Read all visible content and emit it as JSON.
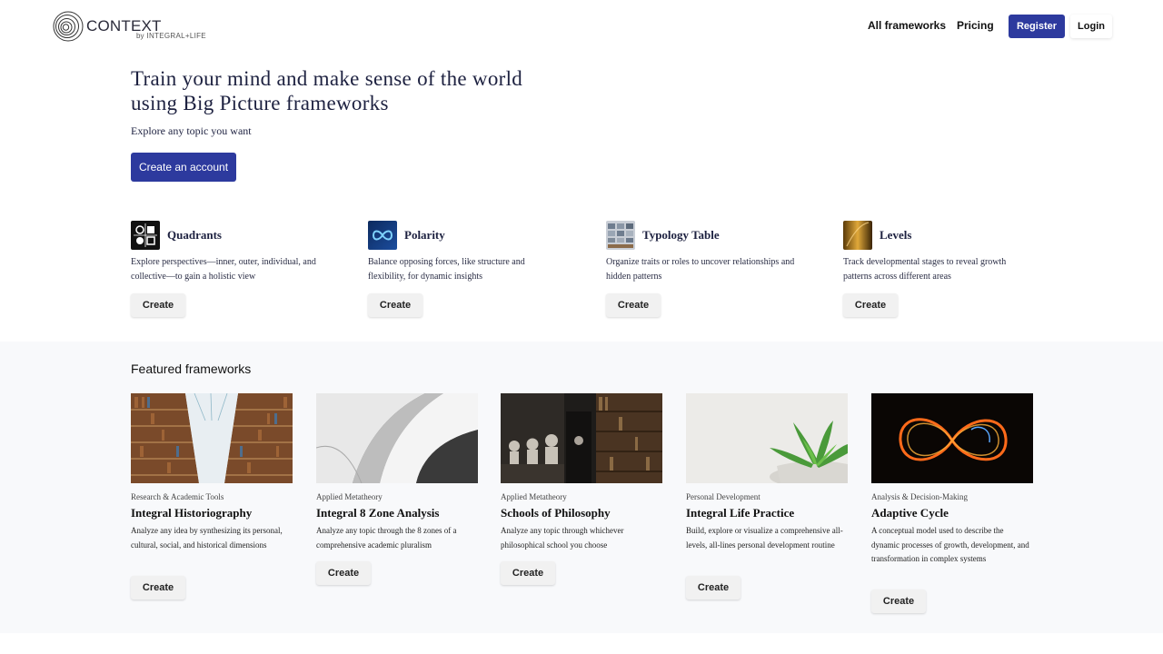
{
  "brand": {
    "name": "CONTEXT",
    "by": "by",
    "company": "INTEGRAL+LIFE"
  },
  "nav": {
    "all_frameworks": "All frameworks",
    "pricing": "Pricing",
    "register": "Register",
    "login": "Login"
  },
  "hero": {
    "title_line1": "Train your mind and make sense of the world",
    "title_line2": "using Big Picture frameworks",
    "subtitle": "Explore any topic you want",
    "cta": "Create an account"
  },
  "tools": [
    {
      "name": "Quadrants",
      "desc": "Explore perspectives—inner, outer, individual, and collective—to gain a holistic view",
      "button": "Create",
      "icon": "quadrants-icon"
    },
    {
      "name": "Polarity",
      "desc": "Balance opposing forces, like structure and flexibility, for dynamic insights",
      "button": "Create",
      "icon": "infinity-icon"
    },
    {
      "name": "Typology Table",
      "desc": "Organize traits or roles to uncover relationships and hidden patterns",
      "button": "Create",
      "icon": "table-icon"
    },
    {
      "name": "Levels",
      "desc": "Track developmental stages to reveal growth patterns across different areas",
      "button": "Create",
      "icon": "levels-icon"
    }
  ],
  "featured": {
    "title": "Featured frameworks",
    "cards": [
      {
        "category": "Research & Academic Tools",
        "title": "Integral Historiography",
        "desc": "Analyze any idea by synthesizing its personal, cultural, social, and historical dimensions",
        "button": "Create",
        "image": "library-image"
      },
      {
        "category": "Applied Metatheory",
        "title": "Integral 8 Zone Analysis",
        "desc": "Analyze any topic through the 8 zones of a comprehensive academic pluralism",
        "button": "Create",
        "image": "spiral-architecture-image"
      },
      {
        "category": "Applied Metatheory",
        "title": "Schools of Philosophy",
        "desc": "Analyze any topic through whichever philosophical school you choose",
        "button": "Create",
        "image": "busts-library-image"
      },
      {
        "category": "Personal Development",
        "title": "Integral Life Practice",
        "desc": "Build, explore or visualize a comprehensive all-levels, all-lines personal development routine",
        "button": "Create",
        "image": "succulent-plant-image"
      },
      {
        "category": "Analysis & Decision-Making",
        "title": "Adaptive Cycle",
        "desc": "A conceptual model used to describe the dynamic processes of growth, development, and transformation in complex systems",
        "button": "Create",
        "image": "light-infinity-image"
      }
    ]
  },
  "colors": {
    "primary": "#2d3a9e",
    "text": "#1d2140",
    "featured_bg": "#f8f9fb",
    "button_bg": "#f1f1f1"
  }
}
